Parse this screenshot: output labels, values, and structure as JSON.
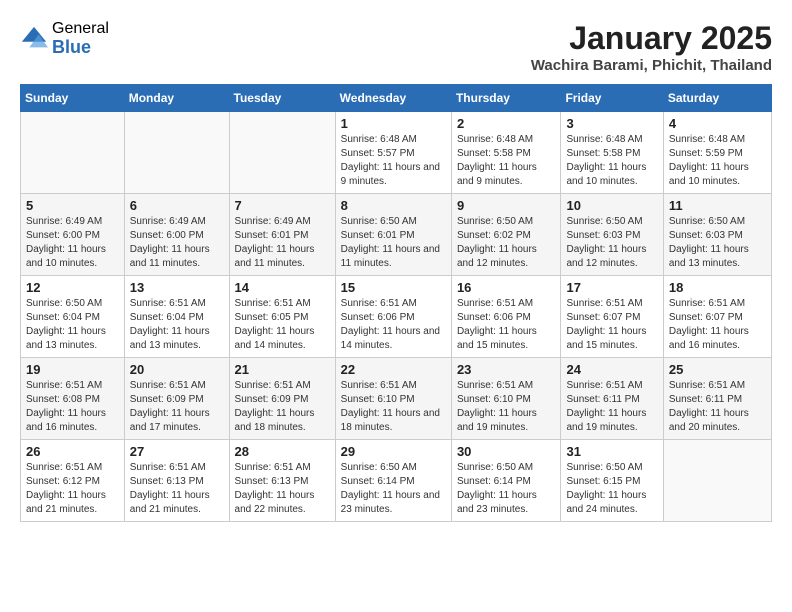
{
  "logo": {
    "general": "General",
    "blue": "Blue"
  },
  "title": "January 2025",
  "subtitle": "Wachira Barami, Phichit, Thailand",
  "days_of_week": [
    "Sunday",
    "Monday",
    "Tuesday",
    "Wednesday",
    "Thursday",
    "Friday",
    "Saturday"
  ],
  "weeks": [
    [
      {
        "num": "",
        "info": ""
      },
      {
        "num": "",
        "info": ""
      },
      {
        "num": "",
        "info": ""
      },
      {
        "num": "1",
        "info": "Sunrise: 6:48 AM\nSunset: 5:57 PM\nDaylight: 11 hours and 9 minutes."
      },
      {
        "num": "2",
        "info": "Sunrise: 6:48 AM\nSunset: 5:58 PM\nDaylight: 11 hours and 9 minutes."
      },
      {
        "num": "3",
        "info": "Sunrise: 6:48 AM\nSunset: 5:58 PM\nDaylight: 11 hours and 10 minutes."
      },
      {
        "num": "4",
        "info": "Sunrise: 6:48 AM\nSunset: 5:59 PM\nDaylight: 11 hours and 10 minutes."
      }
    ],
    [
      {
        "num": "5",
        "info": "Sunrise: 6:49 AM\nSunset: 6:00 PM\nDaylight: 11 hours and 10 minutes."
      },
      {
        "num": "6",
        "info": "Sunrise: 6:49 AM\nSunset: 6:00 PM\nDaylight: 11 hours and 11 minutes."
      },
      {
        "num": "7",
        "info": "Sunrise: 6:49 AM\nSunset: 6:01 PM\nDaylight: 11 hours and 11 minutes."
      },
      {
        "num": "8",
        "info": "Sunrise: 6:50 AM\nSunset: 6:01 PM\nDaylight: 11 hours and 11 minutes."
      },
      {
        "num": "9",
        "info": "Sunrise: 6:50 AM\nSunset: 6:02 PM\nDaylight: 11 hours and 12 minutes."
      },
      {
        "num": "10",
        "info": "Sunrise: 6:50 AM\nSunset: 6:03 PM\nDaylight: 11 hours and 12 minutes."
      },
      {
        "num": "11",
        "info": "Sunrise: 6:50 AM\nSunset: 6:03 PM\nDaylight: 11 hours and 13 minutes."
      }
    ],
    [
      {
        "num": "12",
        "info": "Sunrise: 6:50 AM\nSunset: 6:04 PM\nDaylight: 11 hours and 13 minutes."
      },
      {
        "num": "13",
        "info": "Sunrise: 6:51 AM\nSunset: 6:04 PM\nDaylight: 11 hours and 13 minutes."
      },
      {
        "num": "14",
        "info": "Sunrise: 6:51 AM\nSunset: 6:05 PM\nDaylight: 11 hours and 14 minutes."
      },
      {
        "num": "15",
        "info": "Sunrise: 6:51 AM\nSunset: 6:06 PM\nDaylight: 11 hours and 14 minutes."
      },
      {
        "num": "16",
        "info": "Sunrise: 6:51 AM\nSunset: 6:06 PM\nDaylight: 11 hours and 15 minutes."
      },
      {
        "num": "17",
        "info": "Sunrise: 6:51 AM\nSunset: 6:07 PM\nDaylight: 11 hours and 15 minutes."
      },
      {
        "num": "18",
        "info": "Sunrise: 6:51 AM\nSunset: 6:07 PM\nDaylight: 11 hours and 16 minutes."
      }
    ],
    [
      {
        "num": "19",
        "info": "Sunrise: 6:51 AM\nSunset: 6:08 PM\nDaylight: 11 hours and 16 minutes."
      },
      {
        "num": "20",
        "info": "Sunrise: 6:51 AM\nSunset: 6:09 PM\nDaylight: 11 hours and 17 minutes."
      },
      {
        "num": "21",
        "info": "Sunrise: 6:51 AM\nSunset: 6:09 PM\nDaylight: 11 hours and 18 minutes."
      },
      {
        "num": "22",
        "info": "Sunrise: 6:51 AM\nSunset: 6:10 PM\nDaylight: 11 hours and 18 minutes."
      },
      {
        "num": "23",
        "info": "Sunrise: 6:51 AM\nSunset: 6:10 PM\nDaylight: 11 hours and 19 minutes."
      },
      {
        "num": "24",
        "info": "Sunrise: 6:51 AM\nSunset: 6:11 PM\nDaylight: 11 hours and 19 minutes."
      },
      {
        "num": "25",
        "info": "Sunrise: 6:51 AM\nSunset: 6:11 PM\nDaylight: 11 hours and 20 minutes."
      }
    ],
    [
      {
        "num": "26",
        "info": "Sunrise: 6:51 AM\nSunset: 6:12 PM\nDaylight: 11 hours and 21 minutes."
      },
      {
        "num": "27",
        "info": "Sunrise: 6:51 AM\nSunset: 6:13 PM\nDaylight: 11 hours and 21 minutes."
      },
      {
        "num": "28",
        "info": "Sunrise: 6:51 AM\nSunset: 6:13 PM\nDaylight: 11 hours and 22 minutes."
      },
      {
        "num": "29",
        "info": "Sunrise: 6:50 AM\nSunset: 6:14 PM\nDaylight: 11 hours and 23 minutes."
      },
      {
        "num": "30",
        "info": "Sunrise: 6:50 AM\nSunset: 6:14 PM\nDaylight: 11 hours and 23 minutes."
      },
      {
        "num": "31",
        "info": "Sunrise: 6:50 AM\nSunset: 6:15 PM\nDaylight: 11 hours and 24 minutes."
      },
      {
        "num": "",
        "info": ""
      }
    ]
  ]
}
